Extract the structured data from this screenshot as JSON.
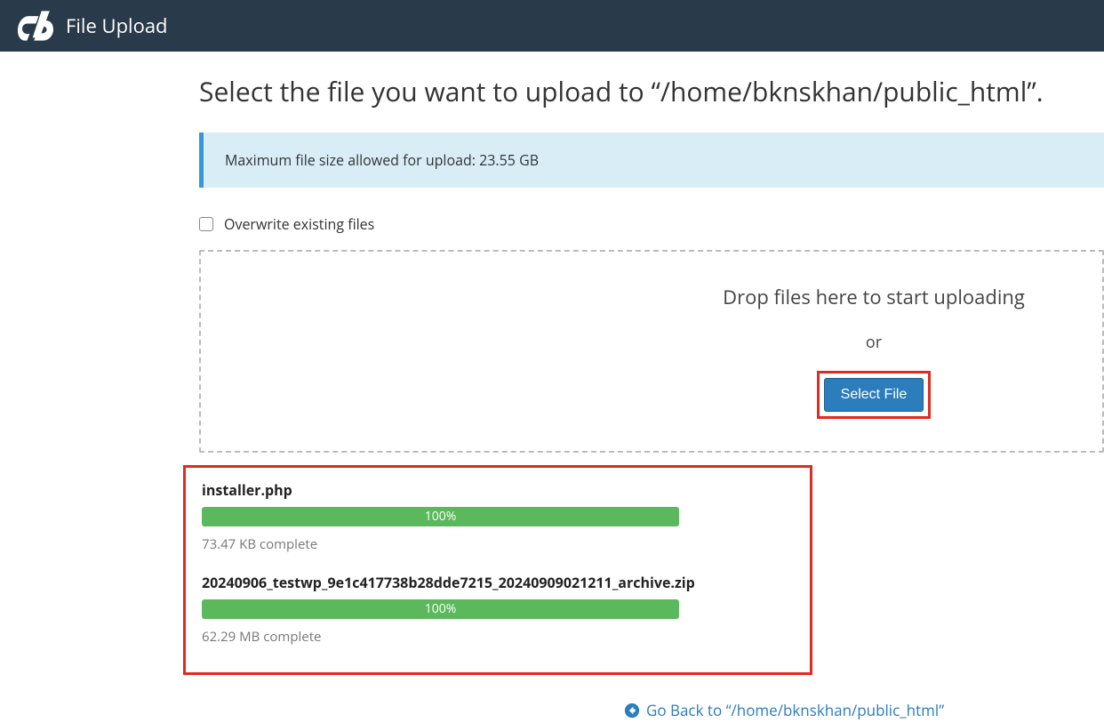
{
  "header": {
    "title": "File Upload"
  },
  "page": {
    "heading": "Select the file you want to upload to “/home/bknskhan/public_html”."
  },
  "info": {
    "max_size_text": "Maximum file size allowed for upload: 23.55 GB"
  },
  "overwrite": {
    "label": "Overwrite existing files"
  },
  "dropzone": {
    "text": "Drop files here to start uploading",
    "or": "or",
    "select_file_label": "Select File"
  },
  "uploads": [
    {
      "filename": "installer.php",
      "percent": "100%",
      "status": "73.47 KB complete"
    },
    {
      "filename": "20240906_testwp_9e1c417738b28dde7215_20240909021211_archive.zip",
      "percent": "100%",
      "status": "62.29 MB complete"
    }
  ],
  "goback": {
    "text": "Go Back to “/home/bknskhan/public_html”"
  }
}
